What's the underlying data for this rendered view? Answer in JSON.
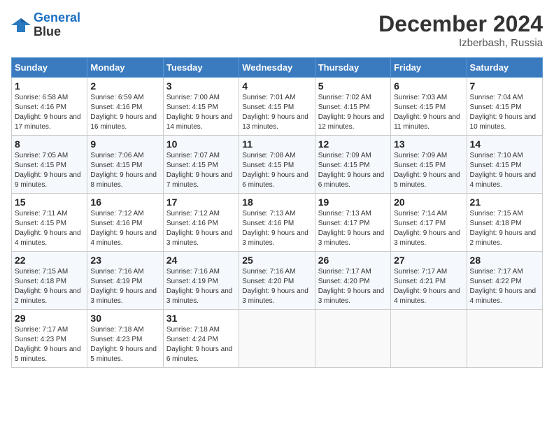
{
  "logo": {
    "line1": "General",
    "line2": "Blue"
  },
  "title": "December 2024",
  "location": "Izberbash, Russia",
  "days_header": [
    "Sunday",
    "Monday",
    "Tuesday",
    "Wednesday",
    "Thursday",
    "Friday",
    "Saturday"
  ],
  "weeks": [
    [
      {
        "num": "1",
        "sunrise": "6:58 AM",
        "sunset": "4:16 PM",
        "daylight": "9 hours and 17 minutes."
      },
      {
        "num": "2",
        "sunrise": "6:59 AM",
        "sunset": "4:16 PM",
        "daylight": "9 hours and 16 minutes."
      },
      {
        "num": "3",
        "sunrise": "7:00 AM",
        "sunset": "4:15 PM",
        "daylight": "9 hours and 14 minutes."
      },
      {
        "num": "4",
        "sunrise": "7:01 AM",
        "sunset": "4:15 PM",
        "daylight": "9 hours and 13 minutes."
      },
      {
        "num": "5",
        "sunrise": "7:02 AM",
        "sunset": "4:15 PM",
        "daylight": "9 hours and 12 minutes."
      },
      {
        "num": "6",
        "sunrise": "7:03 AM",
        "sunset": "4:15 PM",
        "daylight": "9 hours and 11 minutes."
      },
      {
        "num": "7",
        "sunrise": "7:04 AM",
        "sunset": "4:15 PM",
        "daylight": "9 hours and 10 minutes."
      }
    ],
    [
      {
        "num": "8",
        "sunrise": "7:05 AM",
        "sunset": "4:15 PM",
        "daylight": "9 hours and 9 minutes."
      },
      {
        "num": "9",
        "sunrise": "7:06 AM",
        "sunset": "4:15 PM",
        "daylight": "9 hours and 8 minutes."
      },
      {
        "num": "10",
        "sunrise": "7:07 AM",
        "sunset": "4:15 PM",
        "daylight": "9 hours and 7 minutes."
      },
      {
        "num": "11",
        "sunrise": "7:08 AM",
        "sunset": "4:15 PM",
        "daylight": "9 hours and 6 minutes."
      },
      {
        "num": "12",
        "sunrise": "7:09 AM",
        "sunset": "4:15 PM",
        "daylight": "9 hours and 6 minutes."
      },
      {
        "num": "13",
        "sunrise": "7:09 AM",
        "sunset": "4:15 PM",
        "daylight": "9 hours and 5 minutes."
      },
      {
        "num": "14",
        "sunrise": "7:10 AM",
        "sunset": "4:15 PM",
        "daylight": "9 hours and 4 minutes."
      }
    ],
    [
      {
        "num": "15",
        "sunrise": "7:11 AM",
        "sunset": "4:15 PM",
        "daylight": "9 hours and 4 minutes."
      },
      {
        "num": "16",
        "sunrise": "7:12 AM",
        "sunset": "4:16 PM",
        "daylight": "9 hours and 4 minutes."
      },
      {
        "num": "17",
        "sunrise": "7:12 AM",
        "sunset": "4:16 PM",
        "daylight": "9 hours and 3 minutes."
      },
      {
        "num": "18",
        "sunrise": "7:13 AM",
        "sunset": "4:16 PM",
        "daylight": "9 hours and 3 minutes."
      },
      {
        "num": "19",
        "sunrise": "7:13 AM",
        "sunset": "4:17 PM",
        "daylight": "9 hours and 3 minutes."
      },
      {
        "num": "20",
        "sunrise": "7:14 AM",
        "sunset": "4:17 PM",
        "daylight": "9 hours and 3 minutes."
      },
      {
        "num": "21",
        "sunrise": "7:15 AM",
        "sunset": "4:18 PM",
        "daylight": "9 hours and 2 minutes."
      }
    ],
    [
      {
        "num": "22",
        "sunrise": "7:15 AM",
        "sunset": "4:18 PM",
        "daylight": "9 hours and 2 minutes."
      },
      {
        "num": "23",
        "sunrise": "7:16 AM",
        "sunset": "4:19 PM",
        "daylight": "9 hours and 3 minutes."
      },
      {
        "num": "24",
        "sunrise": "7:16 AM",
        "sunset": "4:19 PM",
        "daylight": "9 hours and 3 minutes."
      },
      {
        "num": "25",
        "sunrise": "7:16 AM",
        "sunset": "4:20 PM",
        "daylight": "9 hours and 3 minutes."
      },
      {
        "num": "26",
        "sunrise": "7:17 AM",
        "sunset": "4:20 PM",
        "daylight": "9 hours and 3 minutes."
      },
      {
        "num": "27",
        "sunrise": "7:17 AM",
        "sunset": "4:21 PM",
        "daylight": "9 hours and 4 minutes."
      },
      {
        "num": "28",
        "sunrise": "7:17 AM",
        "sunset": "4:22 PM",
        "daylight": "9 hours and 4 minutes."
      }
    ],
    [
      {
        "num": "29",
        "sunrise": "7:17 AM",
        "sunset": "4:23 PM",
        "daylight": "9 hours and 5 minutes."
      },
      {
        "num": "30",
        "sunrise": "7:18 AM",
        "sunset": "4:23 PM",
        "daylight": "9 hours and 5 minutes."
      },
      {
        "num": "31",
        "sunrise": "7:18 AM",
        "sunset": "4:24 PM",
        "daylight": "9 hours and 6 minutes."
      },
      null,
      null,
      null,
      null
    ]
  ]
}
